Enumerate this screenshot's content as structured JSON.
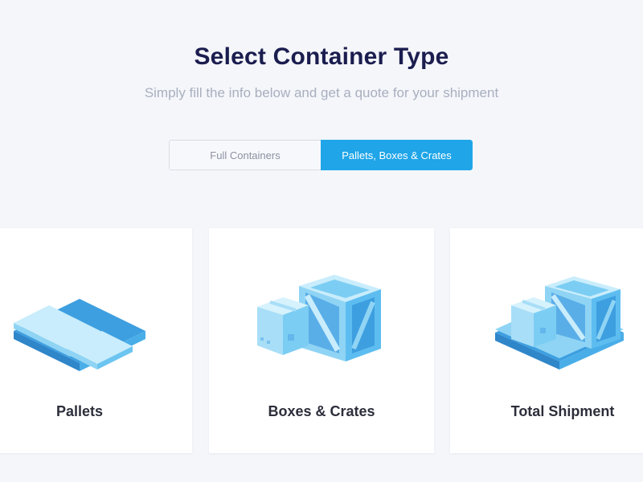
{
  "header": {
    "title": "Select Container Type",
    "subtitle": "Simply fill the info below and get a quote for your shipment"
  },
  "tabs": [
    {
      "label": "Full Containers",
      "active": false
    },
    {
      "label": "Pallets, Boxes & Crates",
      "active": true
    }
  ],
  "cards": [
    {
      "label": "Pallets",
      "icon": "pallet-icon"
    },
    {
      "label": "Boxes & Crates",
      "icon": "box-crate-icon"
    },
    {
      "label": "Total Shipment",
      "icon": "total-shipment-icon"
    }
  ],
  "colors": {
    "accent": "#1fa5e8",
    "title": "#1b1d4f",
    "subtitle": "#a9afbf",
    "background": "#f4f6fa",
    "illustration_light": "#bfe8fb",
    "illustration_mid": "#7ccdf3",
    "illustration_dark": "#3d9fe0"
  }
}
